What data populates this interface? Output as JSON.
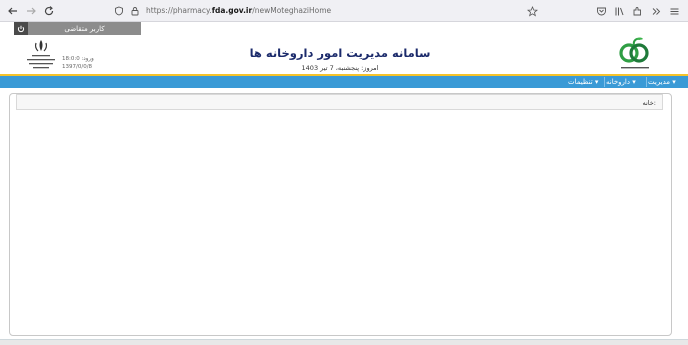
{
  "browser": {
    "url_prefix": "https://pharmacy.",
    "url_domain": "fda.gov.ir",
    "url_path": "/newMoteghaziHome"
  },
  "topbar": {
    "user_label": "کاربر متقاضی"
  },
  "header": {
    "title": "سامانه مدیریت امور داروخانه ها",
    "date_text": "امروز: پنجشنبه، 7 تیر 1403",
    "time_text": "ورود: 18:0:0",
    "date_short": "1397/0/0/8"
  },
  "menu": {
    "items": [
      {
        "label": "مدیریت ▾"
      },
      {
        "label": "داروخانه ▾"
      },
      {
        "label": "تنظیمات ▾"
      }
    ]
  },
  "breadcrumb": {
    "label": "خانه:"
  },
  "colors": {
    "menu": "#3a9ad6",
    "accent_line": "#f6c32a",
    "title": "#1b2a6b"
  }
}
